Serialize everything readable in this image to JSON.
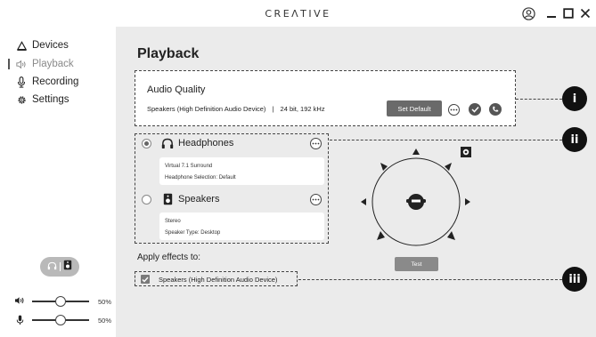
{
  "app": {
    "logo": "CREΛTIVE"
  },
  "sidebar": {
    "items": [
      {
        "label": "Devices",
        "icon": "triangle-icon"
      },
      {
        "label": "Playback",
        "icon": "speaker-wave-icon",
        "active": true
      },
      {
        "label": "Recording",
        "icon": "microphone-icon"
      },
      {
        "label": "Settings",
        "icon": "gear-icon"
      }
    ],
    "output_toggle": {
      "icons": [
        "headphones-icon",
        "speaker-icon"
      ]
    },
    "volume": {
      "value_label": "50%",
      "level": 0.5
    },
    "mic": {
      "value_label": "50%",
      "level": 0.5
    }
  },
  "main": {
    "title": "Playback",
    "audio_quality": {
      "title": "Audio Quality",
      "device": "Speakers (High Definition Audio Device)",
      "separator": "|",
      "format": "24 bit, 192 kHz",
      "set_default_label": "Set Default"
    },
    "devices": [
      {
        "name": "Headphones",
        "selected": true,
        "details": [
          "Virtual 7.1 Surround",
          "Headphone Selection: Default"
        ]
      },
      {
        "name": "Speakers",
        "selected": false,
        "details": [
          "Stereo",
          "Speaker Type: Desktop"
        ]
      }
    ],
    "apply_effects_label": "Apply effects to:",
    "effects_target": "Speakers (High Definition Audio Device)",
    "effects_checked": true,
    "test_label": "Test"
  },
  "callouts": [
    "i",
    "ii",
    "iii"
  ],
  "colors": {
    "main_bg": "#ebebeb",
    "button_dark": "#6a6a6a",
    "callout": "#111111"
  }
}
